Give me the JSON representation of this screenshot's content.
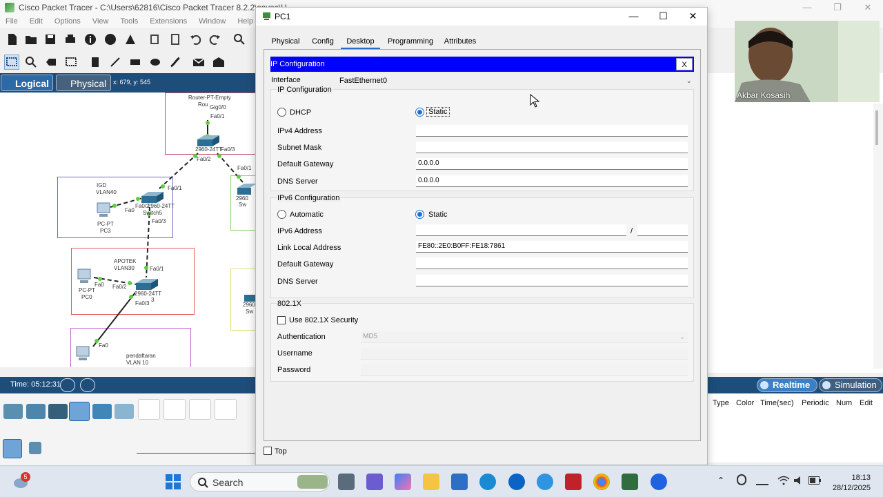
{
  "main_window": {
    "title": "Cisco Packet Tracer - C:\\Users\\62816\\Cisco Packet Tracer 8.2.2\\saves\\U...",
    "menu": [
      "File",
      "Edit",
      "Options",
      "View",
      "Tools",
      "Extensions",
      "Window",
      "Help"
    ],
    "workspace_tabs": {
      "logical": "Logical",
      "physical": "Physical"
    },
    "cursor_coords": "x: 679, y: 545",
    "time": "Time: 05:12:31",
    "realtime_label": "Realtime",
    "simulation_label": "Simulation",
    "event_columns": [
      "Type",
      "Color",
      "Time(sec)",
      "Periodic",
      "Num",
      "Edit"
    ]
  },
  "topology": {
    "labels": {
      "router": "Router-PT-Empty",
      "router2": "Rou",
      "gig": "Gig0/0",
      "fa01_top": "Fa0/1",
      "sw_top": "2960-24TT",
      "fa03_top": "Fa0/3",
      "fa02_top": "Fa0/2",
      "fa01_mid": "Fa0/1",
      "fa01_left": "Fa0/1",
      "igd": "IGD",
      "vlan40": "VLAN40",
      "fa0_pc3": "Fa0",
      "fa02_sw5": "Fa0/2",
      "sw5_model": "2960-24TT",
      "sw5": "Switch5",
      "fa03_sw5": "Fa0/3",
      "pc3_model": "PC-PT",
      "pc3": "PC3",
      "sw_right": "2960",
      "sw_right2": "Sw",
      "apotek": "APOTEK",
      "vlan30": "VLAN30",
      "fa01_ap": "Fa0/1",
      "fa0_pc0": "Fa0",
      "fa02_ap": "Fa0/2",
      "ap_model": "2960-24TT",
      "pc0_model": "PC-PT",
      "pc0": "PC0",
      "fa03_ap": "Fa0/3",
      "ap_sw": "3",
      "sw_right3": "2960",
      "sw_right4": "Sw",
      "fa0_bottom": "Fa0",
      "pendaftaran": "pendaftaran",
      "vlan10": "VLAN 10"
    }
  },
  "pc1": {
    "title": "PC1",
    "tabs": [
      "Physical",
      "Config",
      "Desktop",
      "Programming",
      "Attributes"
    ],
    "active_tab": "Desktop",
    "ip_config": {
      "title": "IP Configuration",
      "close": "X",
      "interface_label": "Interface",
      "interface_value": "FastEthernet0",
      "ipv4": {
        "section": "IP Configuration",
        "dhcp": "DHCP",
        "static": "Static",
        "mode": "Static",
        "ipv4_label": "IPv4 Address",
        "ipv4_value": "",
        "mask_label": "Subnet Mask",
        "mask_value": "",
        "gw_label": "Default Gateway",
        "gw_value": "0.0.0.0",
        "dns_label": "DNS Server",
        "dns_value": "0.0.0.0"
      },
      "ipv6": {
        "section": "IPv6 Configuration",
        "auto": "Automatic",
        "static": "Static",
        "mode": "Static",
        "addr_label": "IPv6 Address",
        "addr_value": "",
        "slash": "/",
        "prefix_value": "",
        "ll_label": "Link Local Address",
        "ll_value": "FE80::2E0:B0FF:FE18:7861",
        "gw_label": "Default Gateway",
        "gw_value": "",
        "dns_label": "DNS Server",
        "dns_value": ""
      },
      "dot1x": {
        "section": "802.1X",
        "use_label": "Use 802.1X Security",
        "checked": false,
        "auth_label": "Authentication",
        "auth_value": "MD5",
        "user_label": "Username",
        "pass_label": "Password"
      }
    },
    "top_label": "Top"
  },
  "webcam": {
    "name": "Akbar Kosasih"
  },
  "taskbar": {
    "search_label": "Search",
    "notification_count": "5",
    "time": "18:13",
    "date": "28/12/2025"
  },
  "colors": {
    "ip_title_bar": "#0000ff",
    "workspace_bar": "#1f4d7a",
    "radio_selected": "#1f6fd1"
  }
}
